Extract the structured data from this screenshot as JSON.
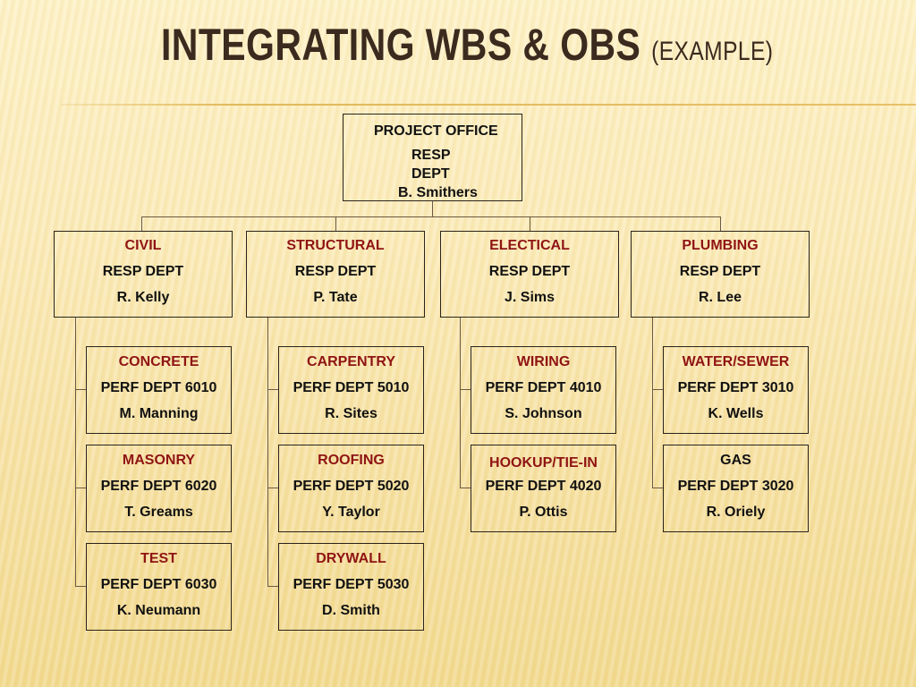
{
  "title": {
    "main": "INTEGRATING WBS & OBS",
    "sub": "(EXAMPLE)"
  },
  "colors": {
    "title": "#3b2a1e",
    "heading_red": "#8f1414",
    "text": "#111111",
    "border": "#2b231b"
  },
  "root": {
    "lines": [
      "PROJECT OFFICE",
      "RESP",
      "DEPT",
      "B. Smithers"
    ]
  },
  "level1": [
    {
      "name": "CIVIL",
      "role": "RESP DEPT",
      "person": "R. Kelly"
    },
    {
      "name": "STRUCTURAL",
      "role": "RESP DEPT",
      "person": "P. Tate"
    },
    {
      "name": "ELECTICAL",
      "role": "RESP DEPT",
      "person": "J. Sims"
    },
    {
      "name": "PLUMBING",
      "role": "RESP DEPT",
      "person": "R. Lee"
    }
  ],
  "level2": [
    [
      {
        "name": "CONCRETE",
        "dept": "PERF DEPT 6010",
        "person": "M. Manning",
        "name_color": "red"
      },
      {
        "name": "MASONRY",
        "dept": "PERF DEPT 6020",
        "person": "T. Greams",
        "name_color": "red"
      },
      {
        "name": "TEST",
        "dept": "PERF DEPT 6030",
        "person": "K. Neumann",
        "name_color": "red"
      }
    ],
    [
      {
        "name": "CARPENTRY",
        "dept": "PERF DEPT 5010",
        "person": "R. Sites",
        "name_color": "red"
      },
      {
        "name": "ROOFING",
        "dept": "PERF DEPT 5020",
        "person": "Y. Taylor",
        "name_color": "red"
      },
      {
        "name": "DRYWALL",
        "dept": "PERF DEPT 5030",
        "person": "D. Smith",
        "name_color": "red"
      }
    ],
    [
      {
        "name": "WIRING",
        "dept": "PERF DEPT 4010",
        "person": "S. Johnson",
        "name_color": "red"
      },
      {
        "name": "HOOKUP/TIE-IN",
        "dept": "PERF DEPT 4020",
        "person": "P. Ottis",
        "name_color": "red"
      }
    ],
    [
      {
        "name": "WATER/SEWER",
        "dept": "PERF DEPT 3010",
        "person": "K. Wells",
        "name_color": "red"
      },
      {
        "name": "GAS",
        "dept": "PERF DEPT 3020",
        "person": "R. Oriely",
        "name_color": "black"
      }
    ]
  ]
}
